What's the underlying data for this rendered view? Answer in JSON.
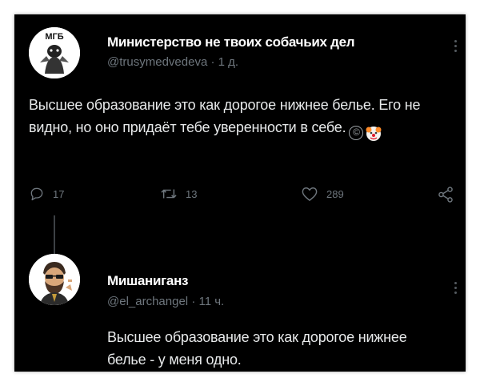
{
  "tweets": [
    {
      "author_name": "Министерство не твоих собачьих дел",
      "handle": "@trusymedvedeva",
      "time": "· 1 д.",
      "text": "Высшее образование это как дорогое нижнее белье. Его не видно, но оно придаёт тебе уверенности в себе.",
      "emojis": [
        "copyright-icon",
        "clown-icon"
      ],
      "stats": {
        "replies": "17",
        "retweets": "13",
        "likes": "289"
      },
      "avatar_caption": "МГБ"
    },
    {
      "author_name": "Мишаниганз",
      "handle": "@el_archangel",
      "time": "· 11 ч.",
      "text": "Высшее образование это как дорогое нижнее белье - у меня одно."
    }
  ],
  "colors": {
    "background": "#000000",
    "name": "#ffffff",
    "text": "#e7e9ea",
    "secondary": "#6e767d"
  }
}
